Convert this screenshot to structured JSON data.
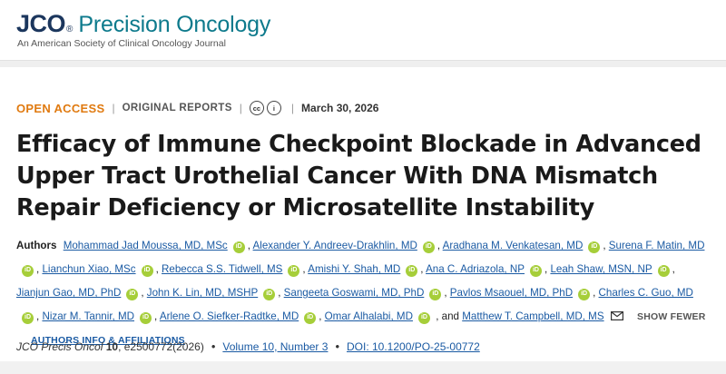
{
  "header": {
    "logo_mark": "JCO",
    "logo_reg": "®",
    "logo_name": "Precision Oncology",
    "logo_subtitle": "An American Society of Clinical Oncology Journal"
  },
  "meta": {
    "access": "OPEN ACCESS",
    "separator": "|",
    "report_type": "ORIGINAL REPORTS",
    "cc_label": "cc",
    "by_label": "i",
    "date": "March 30, 2026"
  },
  "article": {
    "title": "Efficacy of Immune Checkpoint Blockade in Advanced Upper Tract Urothelial Cancer With DNA Mismatch Repair Deficiency or Microsatellite Instability"
  },
  "authors": {
    "label": "Authors",
    "list": [
      "Mohammad Jad Moussa, MD, MSc",
      "Alexander Y. Andreev-Drakhlin, MD",
      "Aradhana M. Venkatesan, MD",
      "Surena F. Matin, MD",
      "Lianchun Xiao, MSc",
      "Rebecca S.S. Tidwell, MS",
      "Amishi Y. Shah, MD",
      "Ana C. Adriazola, NP",
      "Leah Shaw, MSN, NP",
      "Jianjun Gao, MD, PhD",
      "John K. Lin, MD, MSHP",
      "Sangeeta Goswami, MD, PhD",
      "Pavlos Msaouel, MD, PhD",
      "Charles C. Guo, MD",
      "Nizar M. Tannir, MD",
      "Arlene O. Siefker-Radtke, MD",
      "Omar Alhalabi, MD",
      "Matthew T. Campbell, MD, MS"
    ],
    "orcid_label": "iD",
    "and_text": ", and",
    "show_fewer": "SHOW FEWER",
    "affiliations": "AUTHORS INFO & AFFILIATIONS"
  },
  "citation": {
    "journal": "JCO Precis Oncol",
    "volume_bold": "10",
    "article_id": ", e2500772(2026)",
    "bullet": "•",
    "issue": "Volume 10, Number 3",
    "doi": "DOI: 10.1200/PO-25-00772"
  },
  "icons": {
    "orcid": "orcid-icon",
    "mail": "mail-icon",
    "cc": "cc-icon",
    "by": "by-icon"
  },
  "colors": {
    "brand_navy": "#1b365d",
    "brand_teal": "#0d7a8c",
    "open_access": "#e07a10",
    "link": "#1a5aa3",
    "orcid": "#a6ce39"
  }
}
